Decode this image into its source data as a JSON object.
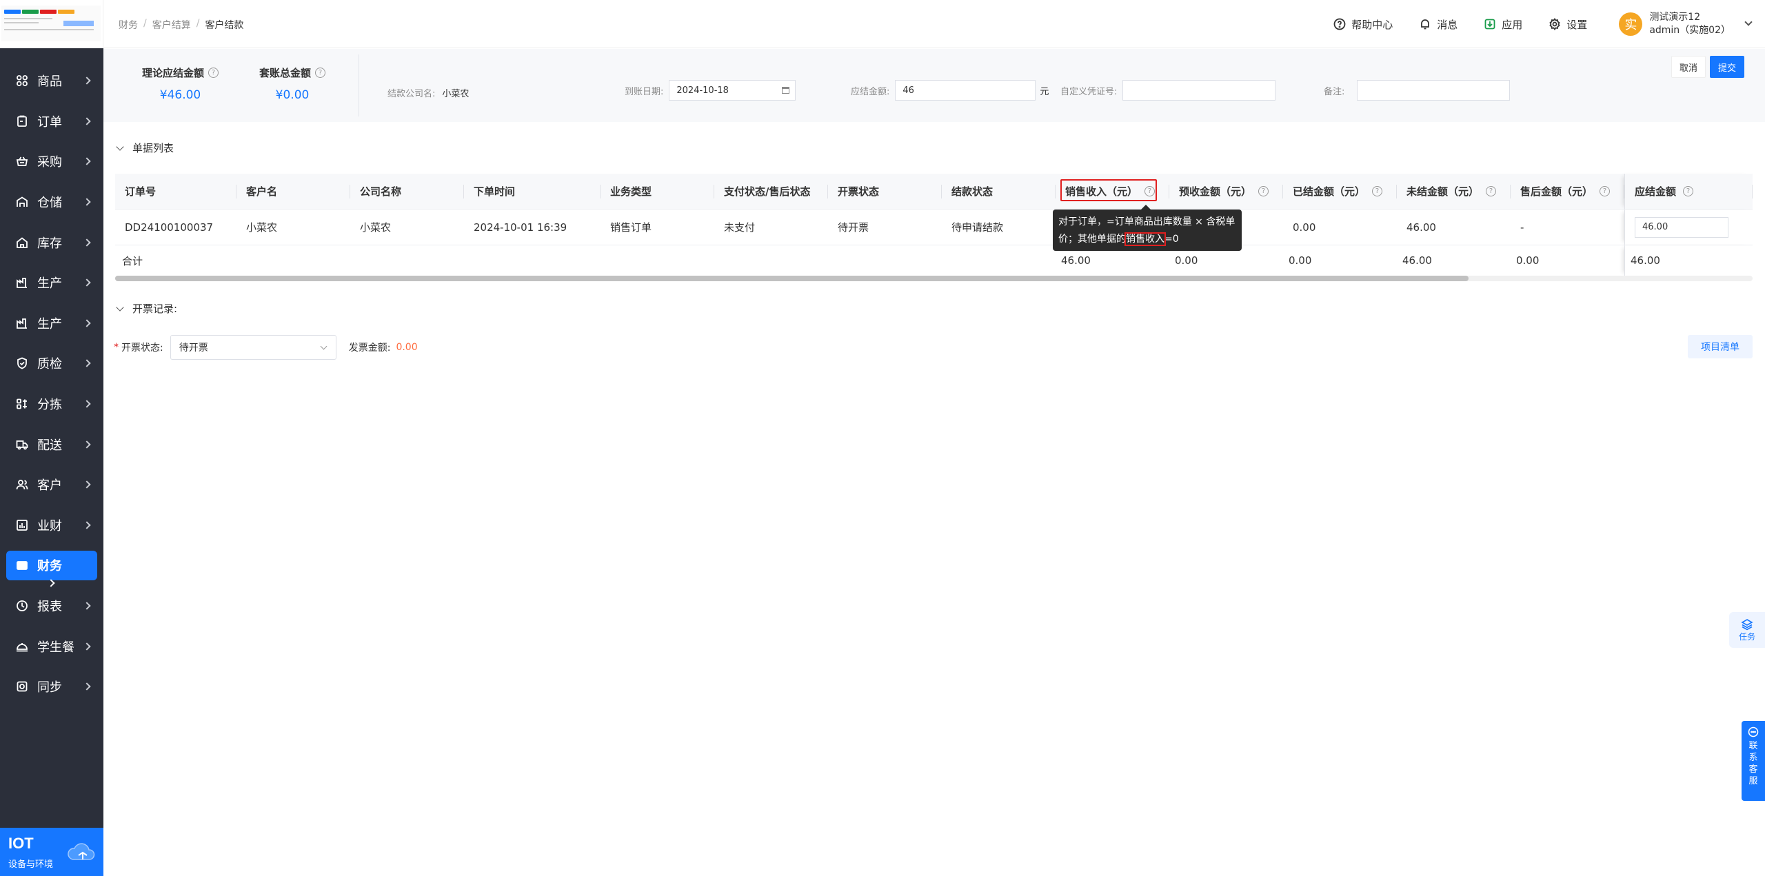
{
  "sidebar": {
    "items": [
      {
        "label": "商品",
        "icon": "grid-icon"
      },
      {
        "label": "订单",
        "icon": "clipboard-icon"
      },
      {
        "label": "采购",
        "icon": "basket-icon"
      },
      {
        "label": "仓储",
        "icon": "warehouse-icon"
      },
      {
        "label": "库存",
        "icon": "home-icon"
      },
      {
        "label": "生产",
        "icon": "factory-icon"
      },
      {
        "label": "生产",
        "icon": "factory-icon"
      },
      {
        "label": "质检",
        "icon": "shield-icon"
      },
      {
        "label": "分拣",
        "icon": "sort-icon"
      },
      {
        "label": "配送",
        "icon": "truck-icon"
      },
      {
        "label": "客户",
        "icon": "users-icon"
      },
      {
        "label": "业财",
        "icon": "chart-icon"
      },
      {
        "label": "财务",
        "icon": "wallet-icon",
        "active": true
      },
      {
        "label": "报表",
        "icon": "clock-icon"
      },
      {
        "label": "学生餐",
        "icon": "meal-icon"
      },
      {
        "label": "同步",
        "icon": "sync-icon"
      }
    ],
    "iot": {
      "title": "IOT",
      "subtitle": "设备与环境"
    }
  },
  "header": {
    "breadcrumb": [
      "财务",
      "客户结算",
      "客户结款"
    ],
    "tools": {
      "help": "帮助中心",
      "messages": "消息",
      "apps": "应用",
      "settings": "设置"
    },
    "user": {
      "avatar_char": "实",
      "name": "测试演示12",
      "role": "admin（实施02）"
    }
  },
  "summary": {
    "theoretical_label": "理论应结金额",
    "theoretical_value": "¥46.00",
    "total_label": "套账总金额",
    "total_value": "¥0.00",
    "company_label": "结款公司名:",
    "company_value": "小菜农",
    "date_label": "到账日期:",
    "date_value": "2024-10-18",
    "amount_label": "应结金额:",
    "amount_value": "46",
    "amount_unit": "元",
    "voucher_label": "自定义凭证号:",
    "voucher_value": "",
    "remark_label": "备注:",
    "remark_value": "",
    "cancel": "取消",
    "submit": "提交"
  },
  "doc_list": {
    "title": "单据列表",
    "columns": [
      "订单号",
      "客户名",
      "公司名称",
      "下单时间",
      "业务类型",
      "支付状态/售后状态",
      "开票状态",
      "结款状态",
      "销售收入（元）",
      "预收金额（元）",
      "已结金额（元）",
      "未结金额（元）",
      "售后金额（元）",
      "应结金额"
    ],
    "row": [
      "DD24100100037",
      "小菜农",
      "小菜农",
      "2024-10-01 16:39",
      "销售订单",
      "未支付",
      "待开票",
      "待申请结款",
      "",
      "",
      "0.00",
      "46.00",
      "-",
      "46.00"
    ],
    "summary_label": "合计",
    "summary": [
      "46.00",
      "0.00",
      "0.00",
      "46.00",
      "0.00",
      "46.00"
    ],
    "tooltip_part1": "对于订单，=订单商品出库数量 × 含税单价；其他单据的",
    "tooltip_hl": "销售收入",
    "tooltip_part2": "=0"
  },
  "invoice": {
    "title": "开票记录:",
    "status_label": "开票状态:",
    "status_value": "待开票",
    "amount_label": "发票金额:",
    "amount_value": "0.00",
    "items_button": "项目清单"
  },
  "widgets": {
    "task": "任务",
    "support": [
      "联",
      "系",
      "客",
      "服"
    ]
  },
  "colors": {
    "primary": "#1677ff",
    "sidebar": "#2b2f3a",
    "highlight": "#e02020",
    "amount_orange": "#ff6b3d"
  }
}
